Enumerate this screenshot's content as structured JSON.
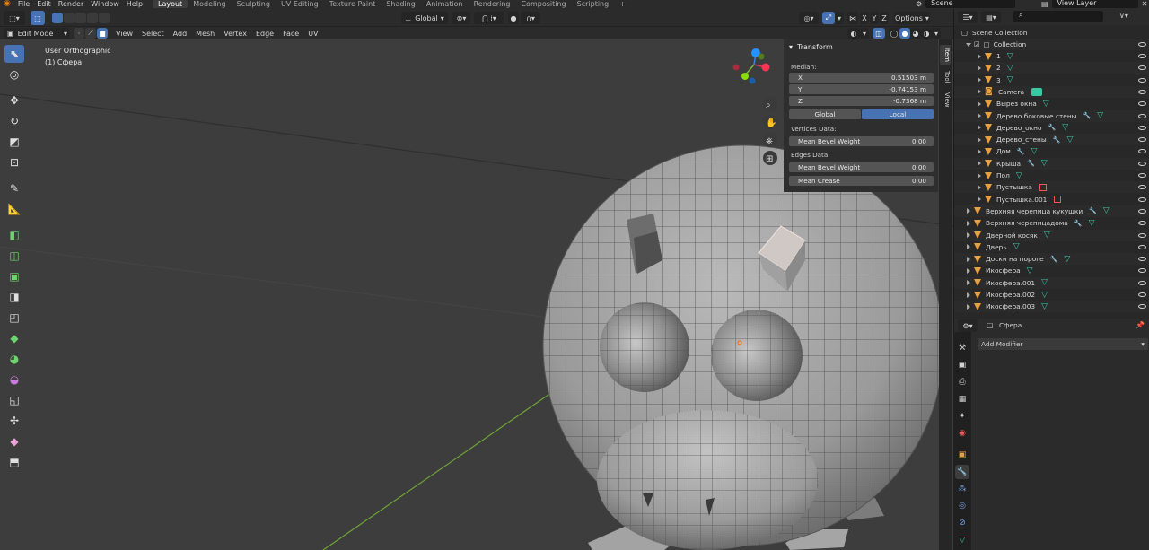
{
  "topbar": {
    "menus": [
      "File",
      "Edit",
      "Render",
      "Window",
      "Help"
    ],
    "workspaces": [
      "Layout",
      "Modeling",
      "Sculpting",
      "UV Editing",
      "Texture Paint",
      "Shading",
      "Animation",
      "Rendering",
      "Compositing",
      "Scripting"
    ],
    "active_workspace": "Layout",
    "add_workspace": "+",
    "scene_label": "Scene",
    "view_layer_label": "View Layer"
  },
  "header": {
    "transform_orientation": "Global",
    "options_label": "Options",
    "axes": [
      "X",
      "Y",
      "Z"
    ]
  },
  "editbar": {
    "mode": "Edit Mode",
    "menus": [
      "View",
      "Select",
      "Add",
      "Mesh",
      "Vertex",
      "Edge",
      "Face",
      "UV"
    ]
  },
  "viewport": {
    "view_name": "User Orthographic",
    "object_name": "(1) Сфера",
    "accent_colors": {
      "x_axis": "#ff3352",
      "y_axis": "#8bdc00",
      "z_axis": "#2890ff",
      "selection": "#4772b3"
    }
  },
  "npanel": {
    "section": "Transform",
    "median_label": "Median:",
    "coords": [
      {
        "axis": "X",
        "value": "0.51503 m"
      },
      {
        "axis": "Y",
        "value": "-0.74153 m"
      },
      {
        "axis": "Z",
        "value": "-0.7368 m"
      }
    ],
    "space_global": "Global",
    "space_local": "Local",
    "vertices_label": "Vertices Data:",
    "vert_bevel_label": "Mean Bevel Weight",
    "vert_bevel_value": "0.00",
    "edges_label": "Edges Data:",
    "edge_bevel_label": "Mean Bevel Weight",
    "edge_bevel_value": "0.00",
    "crease_label": "Mean Crease",
    "crease_value": "0.00",
    "tabs": [
      "Item",
      "Tool",
      "View"
    ]
  },
  "outliner": {
    "search_placeholder": "",
    "root": "Scene Collection",
    "collection": "Collection",
    "items": [
      {
        "name": "1",
        "indent": 2,
        "extra": "v"
      },
      {
        "name": "2",
        "indent": 2,
        "extra": "v"
      },
      {
        "name": "3",
        "indent": 2,
        "extra": "v"
      },
      {
        "name": "Camera",
        "indent": 2,
        "extra": "cam",
        "type": "camera"
      },
      {
        "name": "Вырез окна",
        "indent": 2,
        "extra": "v"
      },
      {
        "name": "Дерево боковые стены",
        "indent": 2,
        "extra": "mv"
      },
      {
        "name": "Дерево_окно",
        "indent": 2,
        "extra": "mv"
      },
      {
        "name": "Дерево_стены",
        "indent": 2,
        "extra": "mv"
      },
      {
        "name": "Дом",
        "indent": 2,
        "extra": "mv"
      },
      {
        "name": "Крыша",
        "indent": 2,
        "extra": "mv"
      },
      {
        "name": "Пол",
        "indent": 2,
        "extra": "v"
      },
      {
        "name": "Пустышка",
        "indent": 2,
        "extra": "e",
        "type": "empty"
      },
      {
        "name": "Пустышка.001",
        "indent": 2,
        "extra": "e",
        "type": "empty"
      },
      {
        "name": "Верхняя черепица кукушки",
        "indent": 1,
        "extra": "mv"
      },
      {
        "name": "Верхняя черепицадома",
        "indent": 1,
        "extra": "mv"
      },
      {
        "name": "Дверной косяк",
        "indent": 1,
        "extra": "v"
      },
      {
        "name": "Дверь",
        "indent": 1,
        "extra": "v"
      },
      {
        "name": "Доски на пороге",
        "indent": 1,
        "extra": "mv"
      },
      {
        "name": "Икосфера",
        "indent": 1,
        "extra": "v"
      },
      {
        "name": "Икосфера.001",
        "indent": 1,
        "extra": "v"
      },
      {
        "name": "Икосфера.002",
        "indent": 1,
        "extra": "v"
      },
      {
        "name": "Икосфера.003",
        "indent": 1,
        "extra": "v"
      }
    ]
  },
  "properties": {
    "object_name": "Сфера",
    "add_modifier": "Add Modifier"
  }
}
